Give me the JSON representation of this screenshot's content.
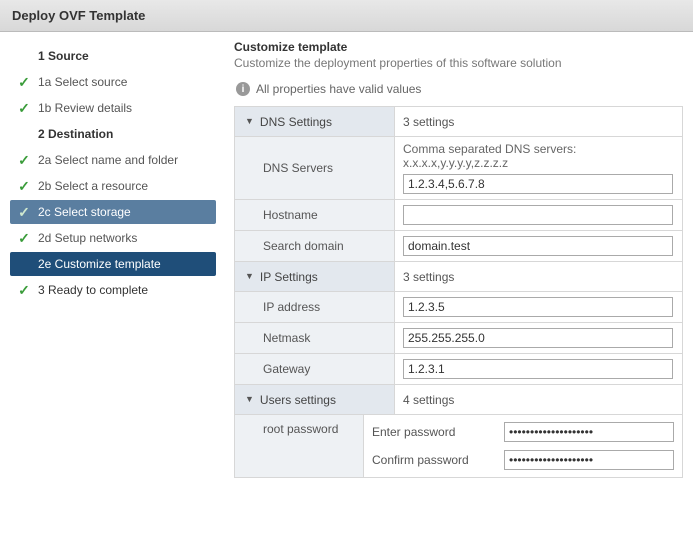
{
  "header": {
    "title": "Deploy OVF Template"
  },
  "sidebar": {
    "s1": "1  Source",
    "s1a": "1a Select source",
    "s1b": "1b Review details",
    "s2": "2  Destination",
    "s2a": "2a Select name and folder",
    "s2b": "2b Select a resource",
    "s2c": "2c Select storage",
    "s2d": "2d Setup networks",
    "s2e": "2e Customize template",
    "s3": "3  Ready to complete"
  },
  "main": {
    "title": "Customize template",
    "subtitle": "Customize the deployment properties of this software solution",
    "valid_msg": "All properties have valid values"
  },
  "sections": {
    "dns": {
      "label": "DNS Settings",
      "count": "3 settings"
    },
    "ip": {
      "label": "IP Settings",
      "count": "3 settings"
    },
    "usr": {
      "label": "Users settings",
      "count": "4 settings"
    }
  },
  "fields": {
    "dns_servers": {
      "label": "DNS Servers",
      "hint": "Comma separated DNS servers: x.x.x.x,y.y.y.y,z.z.z.z",
      "value": "1.2.3.4,5.6.7.8"
    },
    "hostname": {
      "label": "Hostname",
      "value": ""
    },
    "search_domain": {
      "label": "Search domain",
      "value": "domain.test"
    },
    "ip_addr": {
      "label": "IP address",
      "value": "1.2.3.5"
    },
    "netmask": {
      "label": "Netmask",
      "value": "255.255.255.0"
    },
    "gateway": {
      "label": "Gateway",
      "value": "1.2.3.1"
    },
    "root_pw": {
      "label": "root password",
      "enter_label": "Enter password",
      "confirm_label": "Confirm password",
      "enter_value": "********************",
      "confirm_value": "********************"
    }
  }
}
